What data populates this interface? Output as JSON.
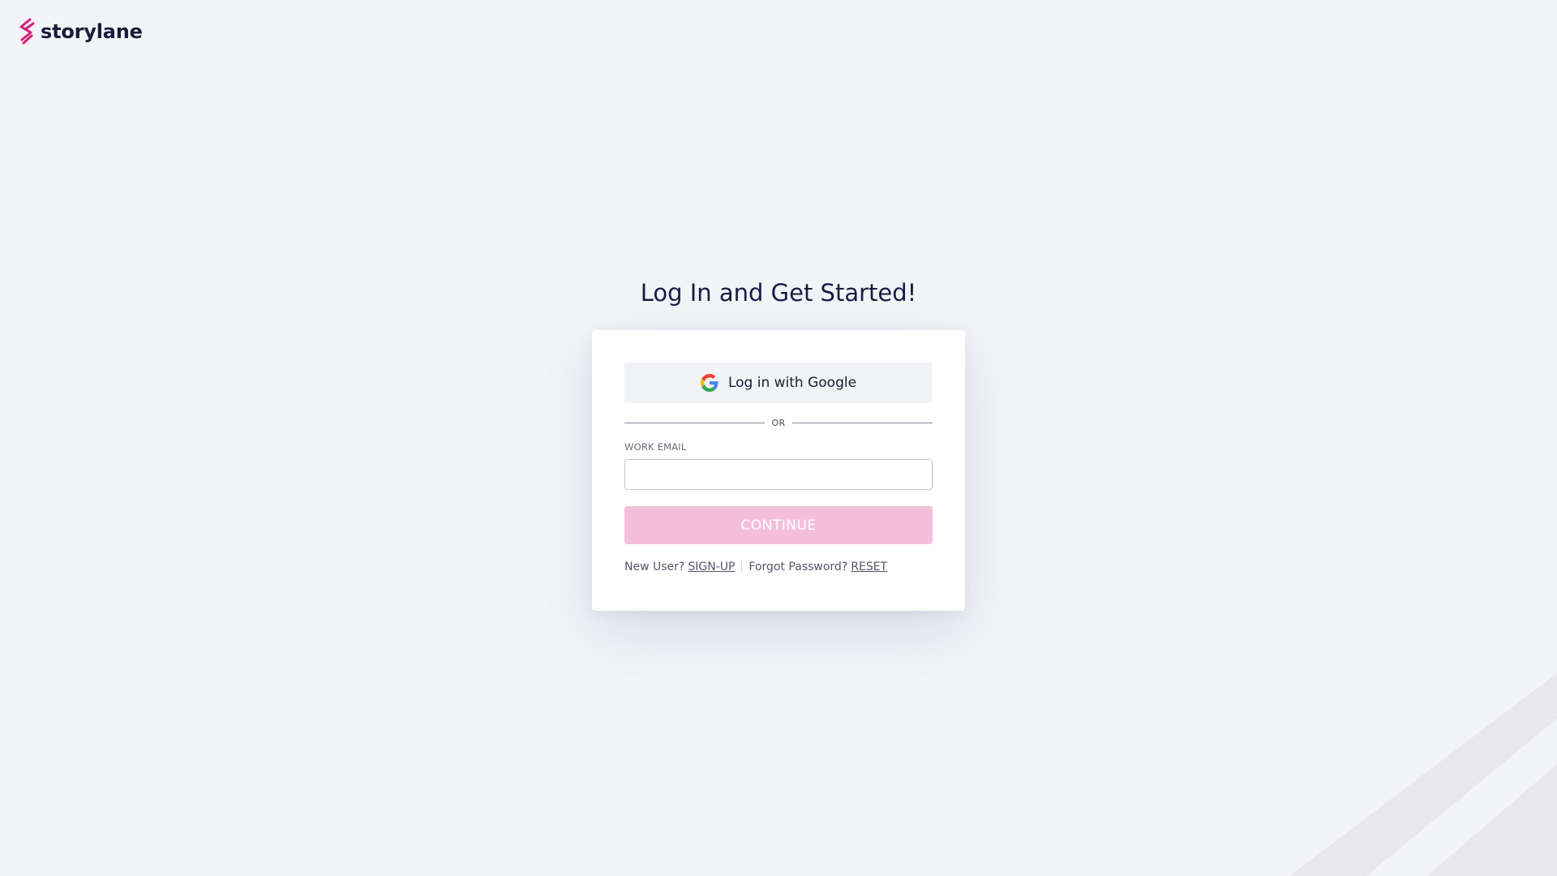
{
  "brand": {
    "name": "storylane",
    "accent_color": "#d61f7e"
  },
  "login": {
    "heading": "Log In and Get Started!",
    "google_button_label": "Log in with Google",
    "divider_label": "OR",
    "email_label": "WORK EMAIL",
    "email_value": "",
    "continue_label": "CONTINUE",
    "continue_color": "#f5bfdc",
    "new_user_text": "New User?",
    "signup_link": "SIGN-UP",
    "forgot_text": "Forgot Password?",
    "reset_link": "RESET"
  }
}
